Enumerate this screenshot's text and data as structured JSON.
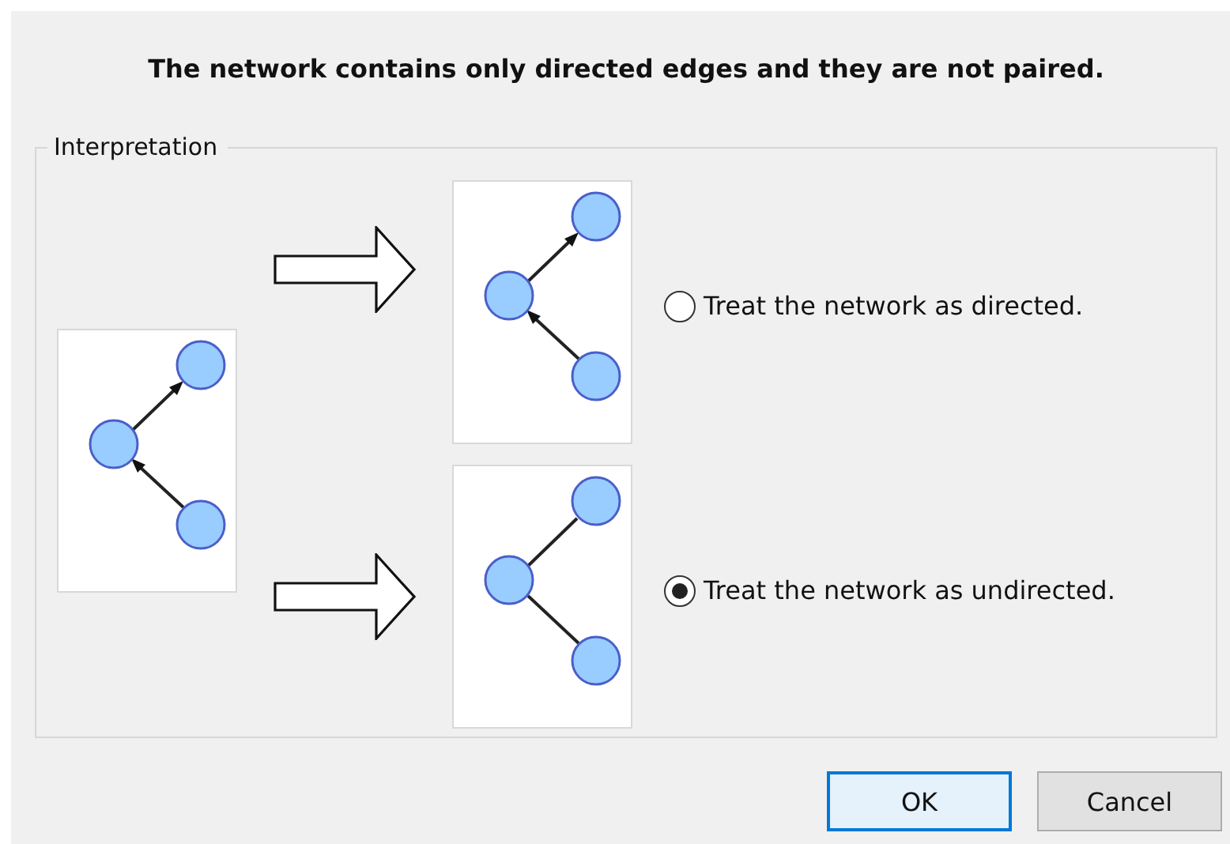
{
  "heading": "The network contains only directed edges and they are not paired.",
  "group": {
    "legend": "Interpretation",
    "source_graph": {
      "kind": "directed"
    },
    "options": [
      {
        "label": "Treat the network as directed.",
        "selected": false,
        "graph": {
          "kind": "directed"
        }
      },
      {
        "label": "Treat the network as undirected.",
        "selected": true,
        "graph": {
          "kind": "undirected"
        }
      }
    ]
  },
  "buttons": [
    {
      "label": "OK",
      "kind": "default"
    },
    {
      "label": "Cancel",
      "kind": "normal"
    }
  ]
}
